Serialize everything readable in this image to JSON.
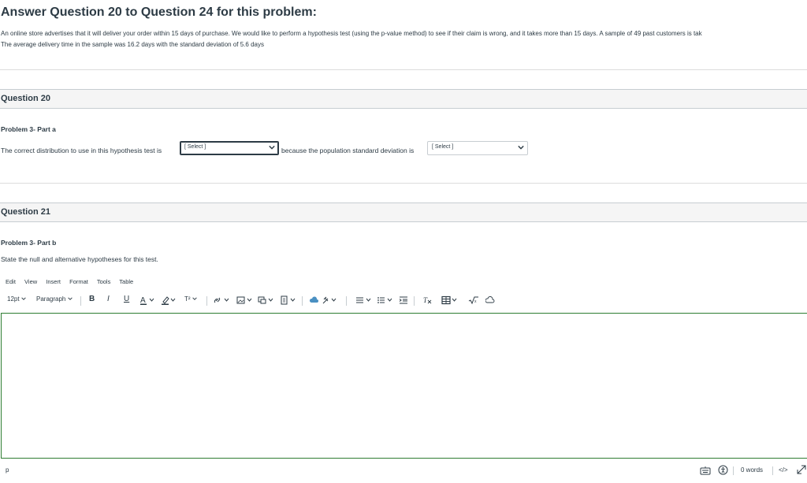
{
  "heading": "Answer Question 20 to Question 24 for this problem:",
  "intro": {
    "line1": "An online store advertises that it will deliver your order within 15 days of purchase. We would like to perform a hypothesis test (using the p-value method) to see if their claim is wrong, and it takes more than 15 days. A sample of 49 past customers is tak",
    "line2": "The average delivery time in the sample was 16.2 days with the standard deviation of  5.6 days"
  },
  "q20": {
    "title": "Question 20",
    "subtitle": "Problem 3- Part a",
    "text_before": "The correct distribution to use in this hypothesis test is",
    "select1": "[ Select ]",
    "text_middle": "because the population standard deviation is",
    "select2": "[ Select ]"
  },
  "q21": {
    "title": "Question 21",
    "subtitle": "Problem 3- Part b",
    "prompt": "State the null and alternative hypotheses for this test."
  },
  "editor": {
    "menu": [
      "Edit",
      "View",
      "Insert",
      "Format",
      "Tools",
      "Table"
    ],
    "font_size": "12pt",
    "block_format": "Paragraph",
    "bold": "B",
    "italic": "I",
    "underline": "U",
    "superscript": "T²",
    "status_path": "p",
    "word_count": "0 words",
    "html_toggle": "</>"
  }
}
